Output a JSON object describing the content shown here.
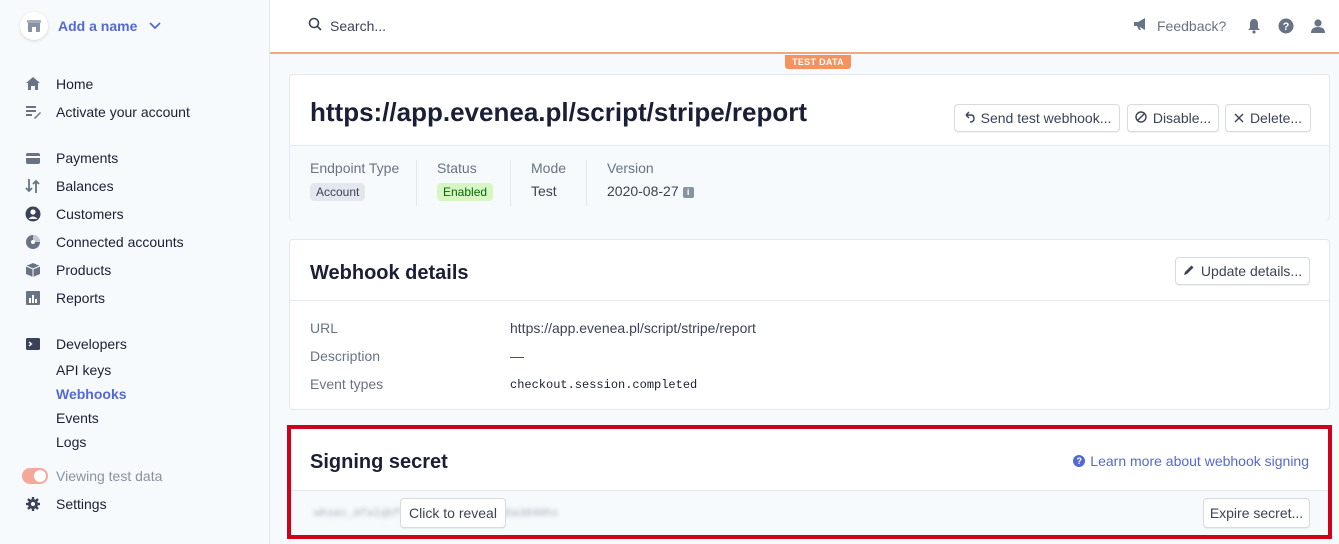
{
  "account": {
    "name": "Add a name"
  },
  "nav": {
    "main": [
      {
        "label": "Home",
        "icon": "home-icon"
      },
      {
        "label": "Activate your account",
        "icon": "checklist-icon"
      }
    ],
    "business": [
      {
        "label": "Payments",
        "icon": "payments-icon"
      },
      {
        "label": "Balances",
        "icon": "balances-icon"
      },
      {
        "label": "Customers",
        "icon": "customers-icon"
      },
      {
        "label": "Connected accounts",
        "icon": "connected-accounts-icon"
      },
      {
        "label": "Products",
        "icon": "products-icon"
      },
      {
        "label": "Reports",
        "icon": "reports-icon"
      }
    ],
    "developers": {
      "label": "Developers",
      "items": [
        "API keys",
        "Webhooks",
        "Events",
        "Logs"
      ],
      "active": "Webhooks"
    },
    "viewing_test_data": "Viewing test data",
    "settings": "Settings"
  },
  "topbar": {
    "search_placeholder": "Search...",
    "feedback": "Feedback?",
    "test_data_badge": "TEST DATA"
  },
  "endpoint": {
    "title": "https://app.evenea.pl/script/stripe/report",
    "buttons": {
      "send_test": "Send test webhook...",
      "disable": "Disable...",
      "delete": "Delete..."
    },
    "meta": {
      "endpoint_type_label": "Endpoint Type",
      "endpoint_type_value": "Account",
      "status_label": "Status",
      "status_value": "Enabled",
      "mode_label": "Mode",
      "mode_value": "Test",
      "version_label": "Version",
      "version_value": "2020-08-27"
    }
  },
  "webhook_details": {
    "title": "Webhook details",
    "update_button": "Update details...",
    "rows": [
      {
        "label": "URL",
        "value": "https://app.evenea.pl/script/stripe/report"
      },
      {
        "label": "Description",
        "value": "—"
      },
      {
        "label": "Event types",
        "value": "checkout.session.completed"
      }
    ]
  },
  "signing_secret": {
    "title": "Signing secret",
    "learn_more": "Learn more about webhook signing",
    "masked_value": "whsec_AfaIqbf9d7e5c1b2a4c0c566a3840hs",
    "reveal_button": "Click to reveal",
    "expire_button": "Expire secret..."
  },
  "colors": {
    "accent": "#5469d4",
    "test_orange": "#f5925e",
    "highlight_red": "#d0021b",
    "enabled_bg": "#d7f7c2",
    "enabled_text": "#05690d"
  }
}
